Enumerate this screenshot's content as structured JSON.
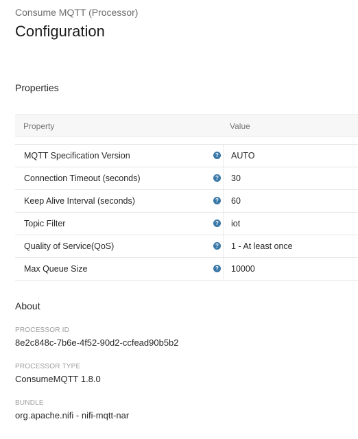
{
  "header": {
    "subtitle": "Consume MQTT (Processor)",
    "title": "Configuration"
  },
  "properties": {
    "section_title": "Properties",
    "columns": {
      "property": "Property",
      "value": "Value"
    },
    "rows": [
      {
        "name": "MQTT Specification Version",
        "value": "AUTO",
        "help_icon": "question-circle-icon"
      },
      {
        "name": "Connection Timeout (seconds)",
        "value": "30",
        "help_icon": "question-circle-icon"
      },
      {
        "name": "Keep Alive Interval (seconds)",
        "value": "60",
        "help_icon": "question-circle-icon"
      },
      {
        "name": "Topic Filter",
        "value": "iot",
        "help_icon": "question-circle-icon"
      },
      {
        "name": "Quality of Service(QoS)",
        "value": "1 - At least once",
        "help_icon": "question-circle-icon"
      },
      {
        "name": "Max Queue Size",
        "value": "10000",
        "help_icon": "question-circle-icon"
      }
    ]
  },
  "about": {
    "section_title": "About",
    "processor_id_label": "PROCESSOR ID",
    "processor_id": "8e2c848c-7b6e-4f52-90d2-ccfead90b5b2",
    "processor_type_label": "PROCESSOR TYPE",
    "processor_type": "ConsumeMQTT 1.8.0",
    "bundle_label": "BUNDLE",
    "bundle": "org.apache.nifi - nifi-mqtt-nar"
  },
  "colors": {
    "help_icon": "#3a78a8",
    "header_bg": "#f7f7f7",
    "muted_text": "#777777"
  }
}
